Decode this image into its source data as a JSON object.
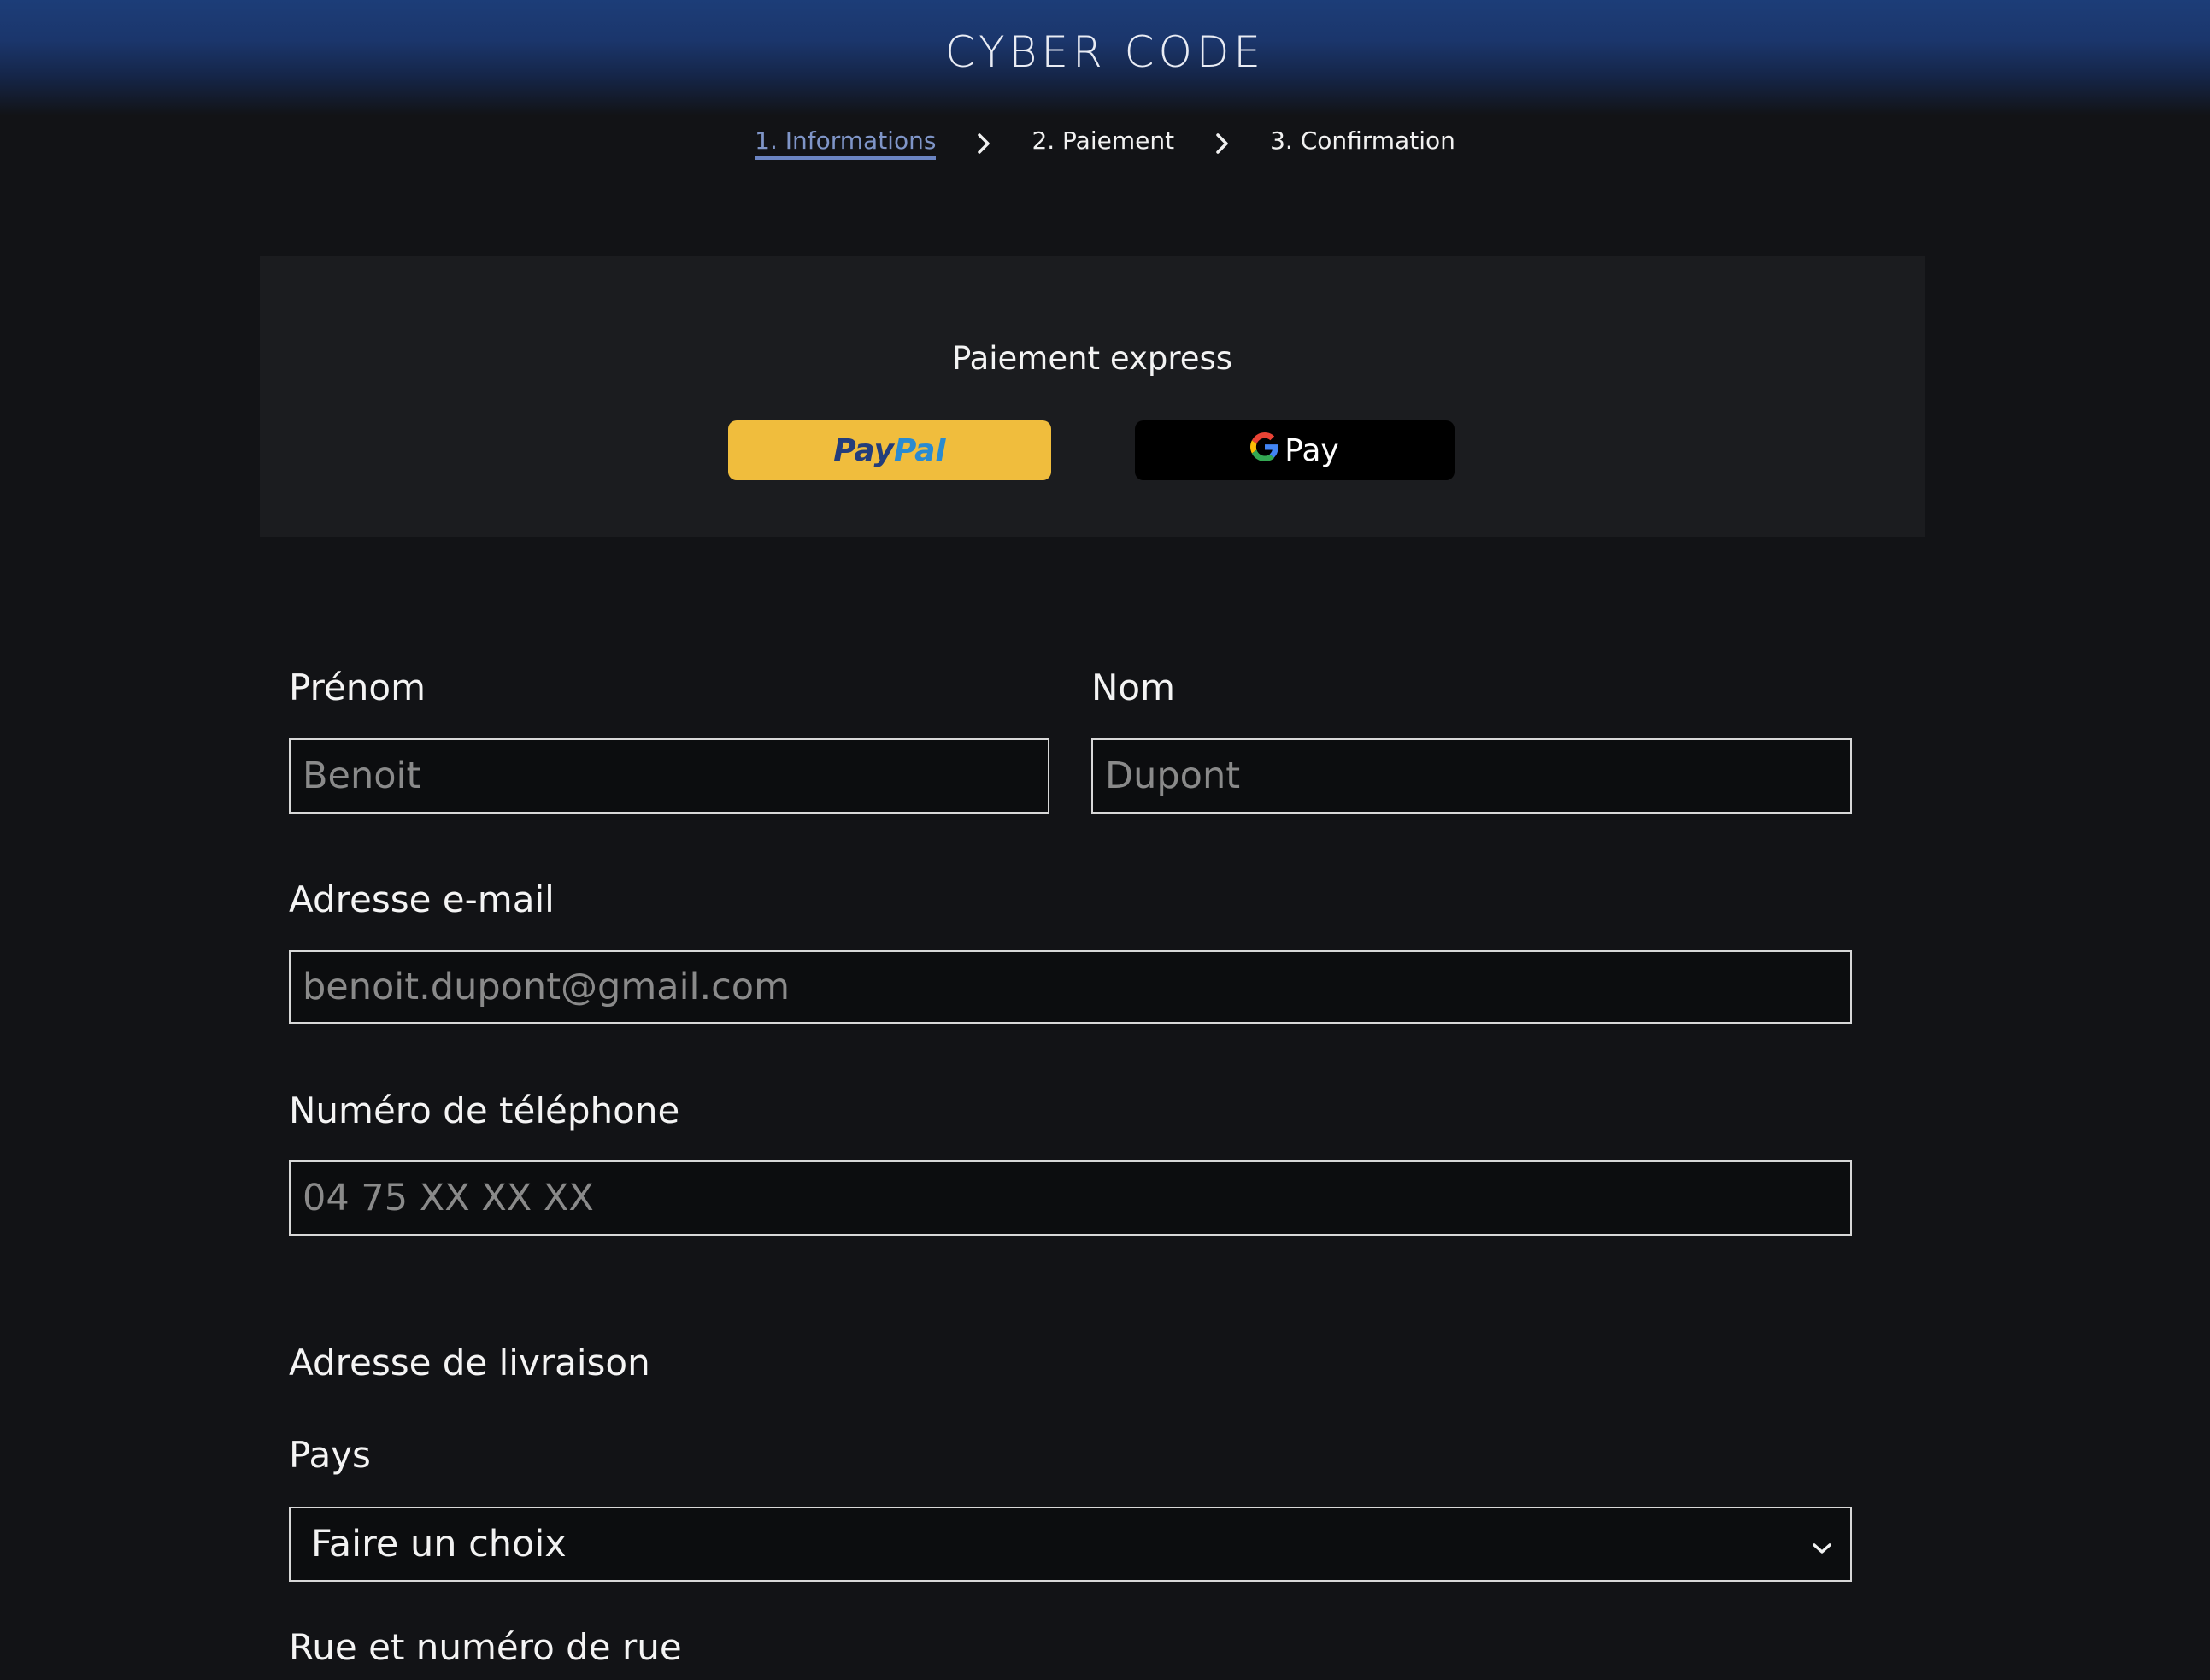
{
  "header": {
    "brand": "CYBER CODE"
  },
  "steps": [
    {
      "label": "1. Informations",
      "active": true
    },
    {
      "label": "2. Paiement",
      "active": false
    },
    {
      "label": "3. Confirmation",
      "active": false
    }
  ],
  "express": {
    "title": "Paiement express",
    "paypal": {
      "part1": "Pay",
      "part2": "Pal"
    },
    "gpay": {
      "label": "Pay"
    }
  },
  "form": {
    "first_name": {
      "label": "Prénom",
      "placeholder": "Benoit"
    },
    "last_name": {
      "label": "Nom",
      "placeholder": "Dupont"
    },
    "email": {
      "label": "Adresse e-mail",
      "placeholder": "benoit.dupont@gmail.com"
    },
    "phone": {
      "label": "Numéro de téléphone",
      "placeholder": "04 75 XX XX XX"
    },
    "shipping_heading": "Adresse de livraison",
    "country": {
      "label": "Pays",
      "value": "Faire un choix"
    },
    "street": {
      "label": "Rue et numéro de rue"
    }
  }
}
